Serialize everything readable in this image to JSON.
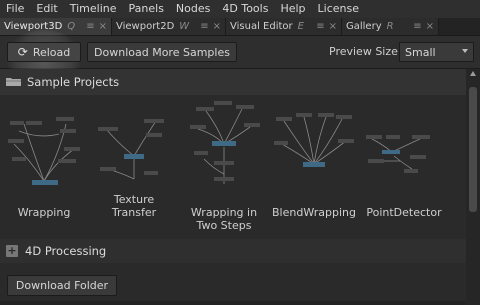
{
  "menubar": {
    "items": [
      "File",
      "Edit",
      "Timeline",
      "Panels",
      "Nodes",
      "4D Tools",
      "Help",
      "License"
    ]
  },
  "tabs": [
    {
      "label": "Viewport3D",
      "key": "Q",
      "active": true
    },
    {
      "label": "Viewport2D",
      "key": "W",
      "active": false
    },
    {
      "label": "Visual Editor",
      "key": "E",
      "active": false
    },
    {
      "label": "Gallery",
      "key": "R",
      "active": false
    }
  ],
  "tab_icons": {
    "menu": "≡",
    "close": "×"
  },
  "toolbar": {
    "reload_label": "Reload",
    "download_samples_label": "Download More Samples",
    "preview_size_label": "Preview Size",
    "preview_size_value": "Small"
  },
  "sections": {
    "sample_projects": "Sample Projects",
    "processing": "4D Processing"
  },
  "samples": [
    {
      "line1": "Wrapping",
      "line2": ""
    },
    {
      "line1": "Texture",
      "line2": "Transfer"
    },
    {
      "line1": "Wrapping in",
      "line2": "Two Steps"
    },
    {
      "line1": "BlendWrapping",
      "line2": ""
    },
    {
      "line1": "PointDetector",
      "line2": ""
    }
  ],
  "download_folder_label": "Download Folder",
  "colors": {
    "background": "#2b2b2b",
    "node_box": "#4a4a4a",
    "node_accent": "#3f6a86",
    "wire": "#8a8a8a"
  }
}
